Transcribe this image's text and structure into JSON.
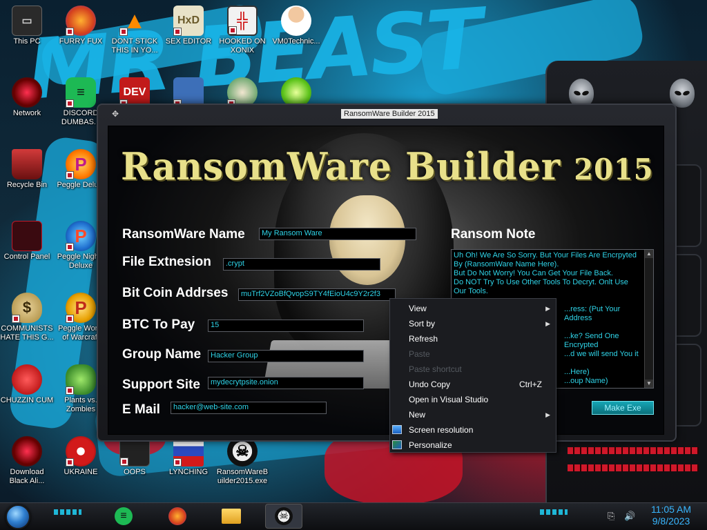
{
  "desktop": {
    "icons": [
      {
        "label": "This PC",
        "icon": "computer-icon"
      },
      {
        "label": "FURRY FUX",
        "icon": "firefox-icon"
      },
      {
        "label": "DONT STICK THIS IN YO...",
        "icon": "vlc-cone-icon"
      },
      {
        "label": "SEX EDITOR",
        "icon": "hxd-editor-icon"
      },
      {
        "label": "HOOKED ON XONIX",
        "icon": "xonix-game-icon"
      },
      {
        "label": "VM0Technic...",
        "icon": "doctor-icon"
      },
      {
        "label": "Network",
        "icon": "network-icon"
      },
      {
        "label": "DISCORD DUMBAS...",
        "icon": "spotify-icon"
      },
      {
        "label": "DEV",
        "icon": "dev-cpp-icon"
      },
      {
        "label": "",
        "icon": "card-icon"
      },
      {
        "label": "",
        "icon": "christmas-icon"
      },
      {
        "label": "",
        "icon": "lime-icon"
      },
      {
        "label": "Recycle Bin",
        "icon": "recycle-bin-icon"
      },
      {
        "label": "Peggle Delu...",
        "icon": "peggle-icon"
      },
      {
        "label": "Control Panel",
        "icon": "control-panel-icon"
      },
      {
        "label": "Peggle Nights Deluxe",
        "icon": "peggle-icon"
      },
      {
        "label": "COMMUNISTS HATE THIS G...",
        "icon": "money-bag-icon"
      },
      {
        "label": "Peggle World of Warcraft",
        "icon": "peggle-icon"
      },
      {
        "label": "CHUZZIN CUM",
        "icon": "chuzzle-icon"
      },
      {
        "label": "Plants vs. Zombies",
        "icon": "plant-icon"
      },
      {
        "label": "Download Black Ali...",
        "icon": "alien-icon"
      },
      {
        "label": "UKRAINE",
        "icon": "radiation-icon"
      },
      {
        "label": "OOPS",
        "icon": "oops-icon"
      },
      {
        "label": "LYNCHING",
        "icon": "flag-icon"
      },
      {
        "label": "RansomWareBuilder2015.exe",
        "icon": "skull-icon"
      }
    ]
  },
  "wallpaper": {
    "text": "MR BEAST"
  },
  "app": {
    "title": "RansomWare Builder 2015",
    "heading_main": "RansomWare Builder",
    "heading_year": "2015",
    "fields": {
      "name": {
        "label": "RansomWare Name",
        "value": "My Ransom Ware"
      },
      "ext": {
        "label": "File Extnesion",
        "value": ".crypt"
      },
      "btc_addr": {
        "label": "Bit Coin Addrses",
        "value": "muTrf2VZoBfQvopS9TY4fEioU4c9Y2r2f3"
      },
      "btc_pay": {
        "label": "BTC To Pay",
        "value": "15"
      },
      "group": {
        "label": "Group Name",
        "value": "Hacker Group"
      },
      "site": {
        "label": "Support Site",
        "value": "mydecrytpsite.onion"
      },
      "email": {
        "label": "E Mail",
        "value": "hacker@web-site.com"
      }
    },
    "note_label": "Ransom Note",
    "note_lines": [
      "Uh Oh! We Are So Sorry. But Your Files Are Encrpyted By (RansomWare Name Here).",
      "But Do Not Worry! You Can Get Your File Back.",
      "Do NOT Try To Use Other Tools To Decryt. Onlt Use Our Tools.",
      "...ress: (Put Your Address",
      "...ke? Send One Encrypted",
      "...d we will send You it",
      "...Here)",
      "...oup Name)"
    ],
    "make_button": "Make Exe"
  },
  "context_menu": {
    "items": [
      {
        "label": "View",
        "submenu": true
      },
      {
        "label": "Sort by",
        "submenu": true
      },
      {
        "label": "Refresh"
      },
      {
        "label": "Paste",
        "disabled": true
      },
      {
        "label": "Paste shortcut",
        "disabled": true
      },
      {
        "label": "Undo Copy",
        "shortcut": "Ctrl+Z"
      },
      {
        "label": "Open in Visual Studio"
      },
      {
        "label": "New",
        "submenu": true
      },
      {
        "label": "Screen resolution",
        "icon": "display-icon"
      },
      {
        "label": "Personalize",
        "icon": "personalize-icon"
      }
    ]
  },
  "taskbar": {
    "apps": [
      "spotify-icon",
      "firefox-icon",
      "file-explorer-icon",
      "ransomware-skull-icon"
    ],
    "time": "11:05 AM",
    "date": "9/8/2023"
  },
  "colors": {
    "accent": "#2fd4e8",
    "title_gold": "#e8e08a",
    "clock_blue": "#39b7ff"
  }
}
